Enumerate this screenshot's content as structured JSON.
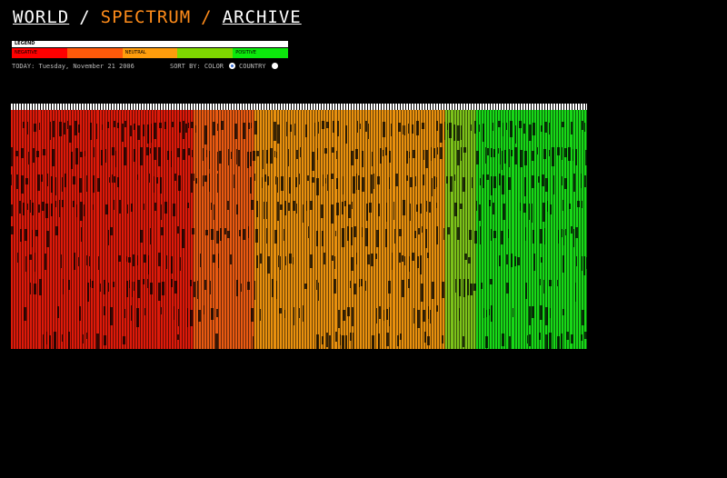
{
  "nav": {
    "world": "WORLD",
    "sep1": "/",
    "spectrum": "SPECTRUM",
    "sep2": "/",
    "archive": "ARCHIVE"
  },
  "legend": {
    "title": "LEGEND",
    "items": [
      {
        "label": "NEGATIVE",
        "color": "#ff0000"
      },
      {
        "label": "",
        "color": "#ff5a0a"
      },
      {
        "label": "NEUTRAL",
        "color": "#ff9d0c"
      },
      {
        "label": "",
        "color": "#7fd800"
      },
      {
        "label": "POSITIVE",
        "color": "#0ce80c"
      }
    ]
  },
  "status": {
    "date_text": "TODAY: Tuesday, November 21 2006",
    "sort_label": "SORT BY: COLOR",
    "country_label": "COUNTRY",
    "sort_selected": "color"
  },
  "spectrum": {
    "segments": [
      {
        "sentiment": "negative",
        "color": "#dd1a0a",
        "count": 66
      },
      {
        "sentiment": "leaning-negative",
        "color": "#e85a12",
        "count": 22
      },
      {
        "sentiment": "neutral",
        "color": "#e8900e",
        "count": 69
      },
      {
        "sentiment": "leaning-positive",
        "color": "#7cc21a",
        "count": 11
      },
      {
        "sentiment": "positive",
        "color": "#18d818",
        "count": 40
      }
    ]
  }
}
